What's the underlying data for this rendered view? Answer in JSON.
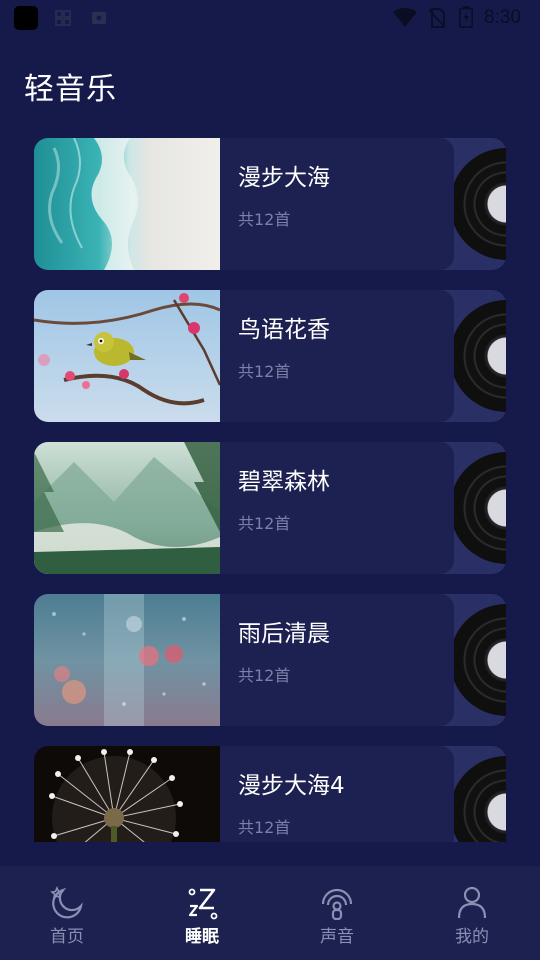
{
  "status_bar": {
    "time": "8:30",
    "icons": [
      "app-icon",
      "grid-icon",
      "media-icon",
      "wifi-icon",
      "no-sim-icon",
      "battery-icon"
    ]
  },
  "page": {
    "title": "轻音乐"
  },
  "albums": [
    {
      "title": "漫步大海",
      "count": "共12首",
      "image": "ocean-shore"
    },
    {
      "title": "鸟语花香",
      "count": "共12首",
      "image": "bird-blossom"
    },
    {
      "title": "碧翠森林",
      "count": "共12首",
      "image": "forest-mountain"
    },
    {
      "title": "雨后清晨",
      "count": "共12首",
      "image": "rain-window"
    },
    {
      "title": "漫步大海4",
      "count": "共12首",
      "image": "dandelion"
    }
  ],
  "bottom_nav": {
    "items": [
      {
        "label": "首页",
        "icon": "moon-star-icon",
        "active": false
      },
      {
        "label": "睡眠",
        "icon": "sleep-zz-icon",
        "active": true
      },
      {
        "label": "声音",
        "icon": "sound-signal-icon",
        "active": false
      },
      {
        "label": "我的",
        "icon": "user-icon",
        "active": false
      }
    ]
  },
  "colors": {
    "background": "#151a4b",
    "card": "#1d2152",
    "card_back": "#2a3066",
    "nav_bg": "#1c214f",
    "muted_text": "#7b7fa6"
  }
}
